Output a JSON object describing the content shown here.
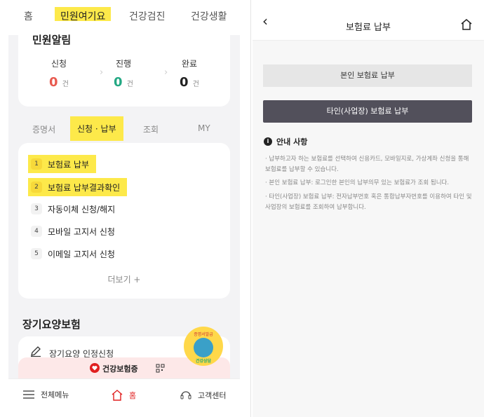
{
  "left": {
    "topnav": [
      "홈",
      "민원여기요",
      "건강검진",
      "건강생활"
    ],
    "civil": {
      "title": "민원알림",
      "stats": [
        {
          "label": "신청",
          "value": "0",
          "unit": "건",
          "color": "#e85a4f"
        },
        {
          "label": "진행",
          "value": "0",
          "unit": "건",
          "color": "#23a883"
        },
        {
          "label": "완료",
          "value": "0",
          "unit": "건",
          "color": "#222222"
        }
      ]
    },
    "subtabs": [
      "증명서",
      "신청 · 납부",
      "조회",
      "MY"
    ],
    "items": [
      {
        "num": "1",
        "label": "보험료 납부"
      },
      {
        "num": "2",
        "label": "보험료 납부결과확인"
      },
      {
        "num": "3",
        "label": "자동이체 신청/해지"
      },
      {
        "num": "4",
        "label": "모바일 고지서 신청"
      },
      {
        "num": "5",
        "label": "이메일 고지서 신청"
      }
    ],
    "more": "더보기 +",
    "section_title": "장기요양보험",
    "section_item": "장기요양 인정신청",
    "banner": "건강보험증",
    "mascot_top": "증명서발급",
    "mascot_bottom": "건강상담",
    "bottomnav": {
      "menu": "전체메뉴",
      "home": "홈",
      "center": "고객센터"
    }
  },
  "right": {
    "title": "보험료 납부",
    "btn_self": "본인 보험료 납부",
    "btn_other": "타인(사업장) 보험료 납부",
    "info_title": "안내 사항",
    "notes": [
      "납부하고자 하는 보험료를 선택하여 신용카드, 모바일지로, 가상계좌 신청을 통해 보험료를 납부할 수 있습니다.",
      "본인 보험료 납부: 로그인한 본인의 납부의무 있는 보험료가 조회 됩니다.",
      "타인(사업장) 보험료 납부: 전자납부번호 혹은 통합납부자번호를 이용하여 타인 및 사업장의 보험료를 조회하여 납부합니다."
    ]
  },
  "colors": {
    "highlight": "#fde94a",
    "dark_button": "#52505b"
  }
}
